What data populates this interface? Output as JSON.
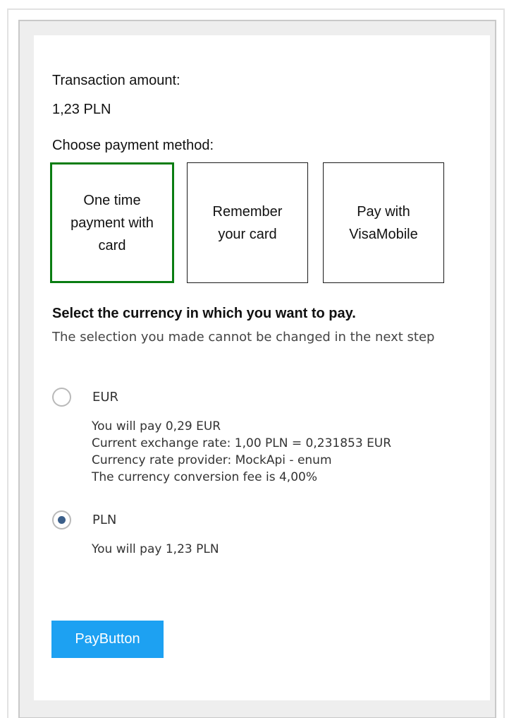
{
  "transaction": {
    "amount_label": "Transaction amount:",
    "amount_value": "1,23 PLN"
  },
  "payment_method": {
    "label": "Choose payment method:",
    "options": [
      {
        "label": "One time payment with card",
        "selected": true
      },
      {
        "label": "Remember your card",
        "selected": false
      },
      {
        "label": "Pay with VisaMobile",
        "selected": false
      }
    ],
    "selected_border_color": "#0a7d12"
  },
  "currency": {
    "heading": "Select the currency in which you want to pay.",
    "note": "The selection you made cannot be changed in the next step",
    "options": [
      {
        "code": "EUR",
        "checked": false,
        "details": [
          "You will pay 0,29 EUR",
          "Current exchange rate: 1,00 PLN = 0,231853 EUR",
          "Currency rate provider: MockApi - enum",
          "The currency conversion fee is 4,00%"
        ]
      },
      {
        "code": "PLN",
        "checked": true,
        "details": [
          "You will pay 1,23 PLN"
        ]
      }
    ]
  },
  "pay_button": {
    "label": "PayButton",
    "color": "#1da1f2"
  }
}
